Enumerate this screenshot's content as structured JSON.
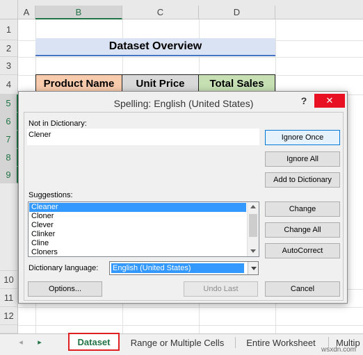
{
  "sheet": {
    "columns": [
      "A",
      "B",
      "C",
      "D"
    ],
    "rows": [
      "1",
      "2",
      "3",
      "4",
      "5",
      "6",
      "7",
      "8",
      "9",
      "10",
      "11",
      "12"
    ],
    "title": "Dataset Overview",
    "headers": {
      "product": "Product Name",
      "price": "Unit Price",
      "sales": "Total Sales"
    },
    "colors": {
      "product_header": "#f8cbad",
      "price_header": "#d9d9d9",
      "sales_header": "#c6e0b4",
      "title_fill": "#dae3f3",
      "title_border": "#4472c4"
    }
  },
  "dialog": {
    "title": "Spelling: English (United States)",
    "help": "?",
    "close": "✕",
    "not_in_dict_label": "Not in Dictionary:",
    "misspelled_word": "Clener",
    "suggestions_label": "Suggestions:",
    "suggestions": [
      "Cleaner",
      "Cloner",
      "Clever",
      "Clinker",
      "Cline",
      "Cloners"
    ],
    "dict_lang_label": "Dictionary language:",
    "dict_lang_value": "English (United States)",
    "buttons": {
      "ignore_once": "Ignore Once",
      "ignore_all": "Ignore All",
      "add_to_dictionary": "Add to Dictionary",
      "change": "Change",
      "change_all": "Change All",
      "autocorrect": "AutoCorrect",
      "options": "Options...",
      "undo_last": "Undo Last",
      "cancel": "Cancel"
    }
  },
  "tabs": {
    "items": [
      "Dataset",
      "Range or Multiple Cells",
      "Entire Worksheet",
      "Multip"
    ],
    "active": "Dataset",
    "left_arrow": "◂",
    "right_arrow": "▸"
  },
  "watermark": "wsxdn.com"
}
